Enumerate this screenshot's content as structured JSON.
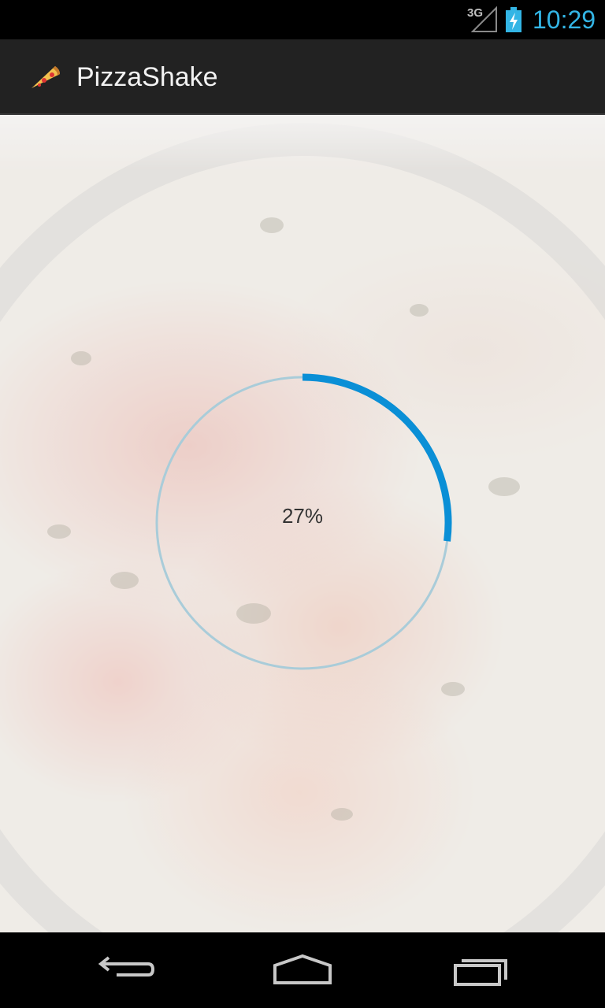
{
  "status_bar": {
    "network_label": "3G",
    "network_icon": "signal-icon",
    "battery_icon": "battery-charging-icon",
    "time": "10:29",
    "time_color": "#33b5e5"
  },
  "action_bar": {
    "app_icon": "pizza-slice-icon",
    "title": "PizzaShake",
    "background": "#222222"
  },
  "progress": {
    "value_text": "27%",
    "value": 0.27,
    "accent_color": "#0a8fd6",
    "track_color": "#a9ccd9"
  },
  "nav_bar": {
    "back_icon": "back-icon",
    "home_icon": "home-icon",
    "recents_icon": "recents-icon"
  }
}
